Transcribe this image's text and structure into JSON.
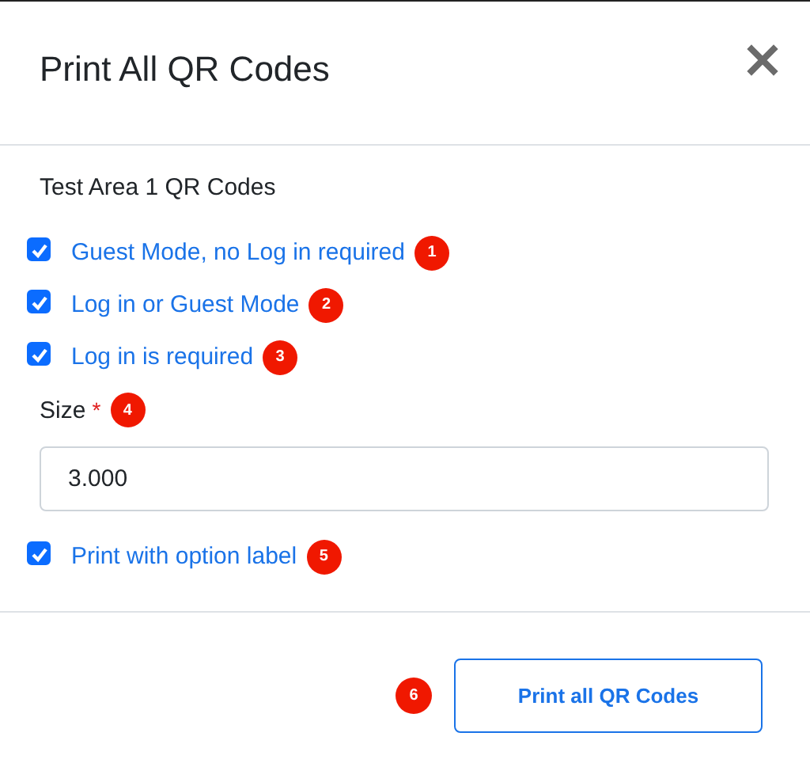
{
  "dialog": {
    "title": "Print All QR Codes"
  },
  "section_title": "Test Area 1 QR Codes",
  "options": [
    {
      "label": "Guest Mode, no Log in required",
      "checked": true,
      "badge": "1"
    },
    {
      "label": "Log in or Guest Mode",
      "checked": true,
      "badge": "2"
    },
    {
      "label": "Log in is required",
      "checked": true,
      "badge": "3"
    }
  ],
  "size_field": {
    "label": "Size",
    "required_mark": "*",
    "badge": "4",
    "value": "3.000"
  },
  "label_option": {
    "label": "Print with option label",
    "checked": true,
    "badge": "5"
  },
  "footer": {
    "badge": "6",
    "button": "Print all QR Codes"
  }
}
